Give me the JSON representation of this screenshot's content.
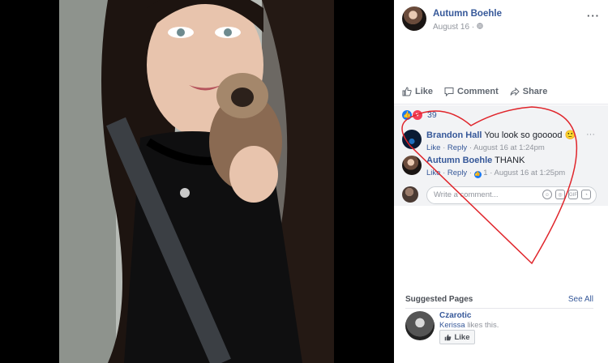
{
  "post": {
    "author": "Autumn Boehle",
    "date": "August 16 · ",
    "privacy_icon": "globe-icon",
    "more": "···"
  },
  "actions": {
    "like": "Like",
    "comment": "Comment",
    "share": "Share"
  },
  "reactions": {
    "count": "39",
    "like_icon": "thumbs-up-icon",
    "love_icon": "heart-icon"
  },
  "comments": [
    {
      "name": "Brandon Hall",
      "text": "You look so gooood 🙂",
      "like": "Like",
      "reply": "Reply",
      "time": " · August 16 at 1:24pm"
    },
    {
      "name": "Autumn Boehle",
      "text": "THANK",
      "like": "Like",
      "reply": "Reply",
      "like_count": "1",
      "time": " · August 16 at 1:25pm"
    }
  ],
  "write_comment": {
    "placeholder": "Write a comment..."
  },
  "suggested": {
    "title": "Suggested Pages",
    "see_all": "See All",
    "page_name": "Czarotic",
    "likes_user": "Kerissa",
    "likes_text": " likes this.",
    "like_button": "Like"
  },
  "colors": {
    "link": "#365899",
    "annotation": "#e0252b"
  }
}
